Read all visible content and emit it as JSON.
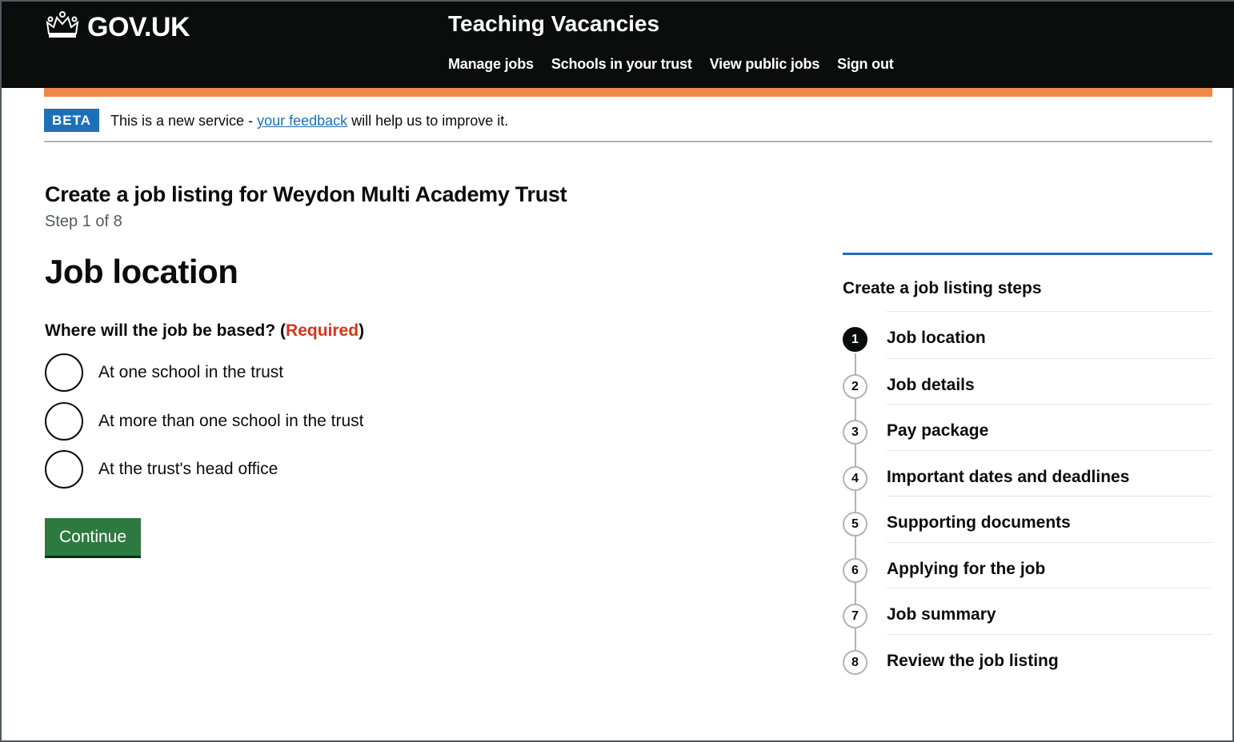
{
  "header": {
    "logo_text": "GOV.UK",
    "service_name": "Teaching Vacancies",
    "nav": [
      "Manage jobs",
      "Schools in your trust",
      "View public jobs",
      "Sign out"
    ]
  },
  "beta": {
    "tag": "BETA",
    "text_before": "This is a new service - ",
    "link": "your feedback",
    "text_after": " will help us to improve it."
  },
  "main": {
    "caption": "Create a job listing for Weydon Multi Academy Trust",
    "step": "Step 1 of 8",
    "title": "Job location",
    "question": "Where will the job be based? (",
    "required": "Required",
    "question_end": ")",
    "options": [
      "At one school in the trust",
      "At more than one school in the trust",
      "At the trust's head office"
    ],
    "continue_label": "Continue"
  },
  "steps": {
    "title": "Create a job listing steps",
    "items": [
      {
        "num": "1",
        "label": "Job location"
      },
      {
        "num": "2",
        "label": "Job details"
      },
      {
        "num": "3",
        "label": "Pay package"
      },
      {
        "num": "4",
        "label": "Important dates and deadlines"
      },
      {
        "num": "5",
        "label": "Supporting documents"
      },
      {
        "num": "6",
        "label": "Applying for the job"
      },
      {
        "num": "7",
        "label": "Job summary"
      },
      {
        "num": "8",
        "label": "Review the job listing"
      }
    ]
  },
  "colors": {
    "header_bg": "#0b0c0c",
    "accent_orange": "#f0874a",
    "link_blue": "#1d70b8",
    "required_red": "#d4351c",
    "button_green": "#2c7a3f"
  }
}
